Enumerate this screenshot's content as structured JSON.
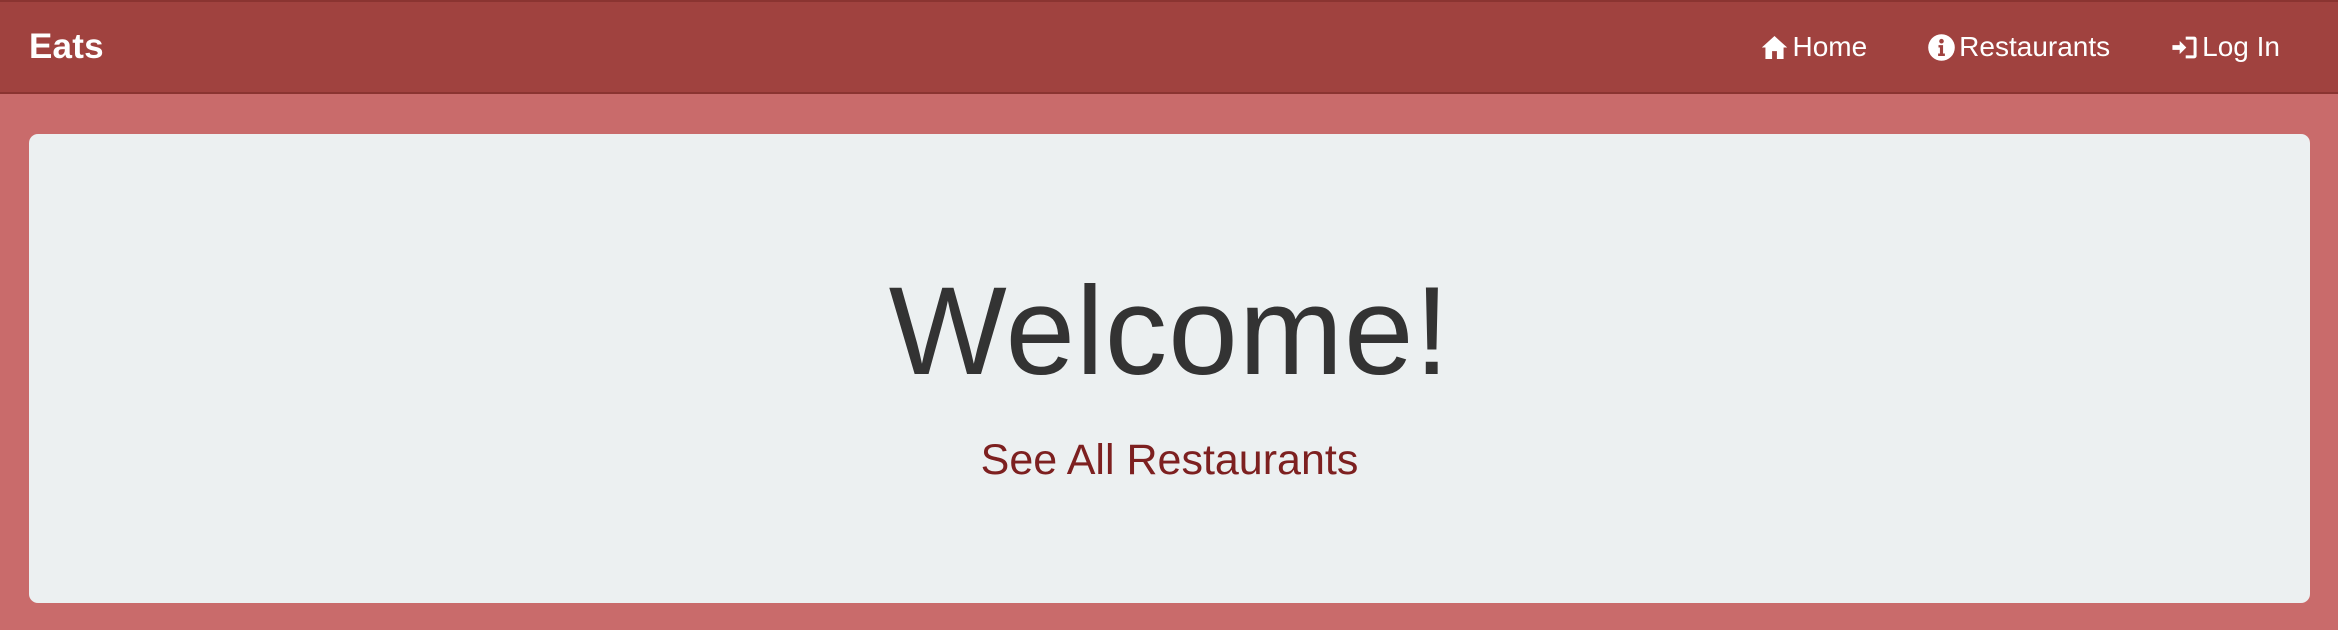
{
  "navbar": {
    "brand": "Eats",
    "links": [
      {
        "label": "Home",
        "icon": "home-icon"
      },
      {
        "label": "Restaurants",
        "icon": "info-icon"
      },
      {
        "label": "Log In",
        "icon": "log-in-icon"
      }
    ]
  },
  "hero": {
    "title": "Welcome!",
    "link_label": "See All Restaurants"
  },
  "colors": {
    "navbar_bg": "#a0423f",
    "page_bg": "#c96b6b",
    "hero_bg": "#ecf0f1",
    "link_color": "#7d2020"
  }
}
